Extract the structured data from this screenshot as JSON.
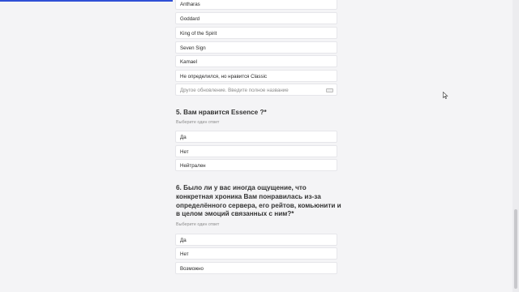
{
  "q4": {
    "options": [
      {
        "label": "Antharas"
      },
      {
        "label": "Goddard"
      },
      {
        "label": "King of the Spirit"
      },
      {
        "label": "Seven Sign"
      },
      {
        "label": "Kamael"
      },
      {
        "label": "Не определился, но нравится Classic"
      }
    ],
    "other_placeholder": "Другое обновление. Введите полное название"
  },
  "q5": {
    "title": "5. Вам нравится Essence ?*",
    "hint": "Выберите один ответ",
    "options": [
      {
        "label": "Да"
      },
      {
        "label": "Нет"
      },
      {
        "label": "Нейтрален"
      }
    ]
  },
  "q6": {
    "title": "6. Было ли у вас иногда ощущение, что конкретная хроника Вам понравилась из-за определённого сервера, его рейтов, комьюнити и в целом эмоций связанных с ним?*",
    "hint": "Выберите один ответ",
    "options": [
      {
        "label": "Да"
      },
      {
        "label": "Нет"
      },
      {
        "label": "Возможно"
      }
    ]
  },
  "colors": {
    "accent": "#2f4fd6",
    "background": "#f4f4f6",
    "option_bg": "#ffffff"
  }
}
